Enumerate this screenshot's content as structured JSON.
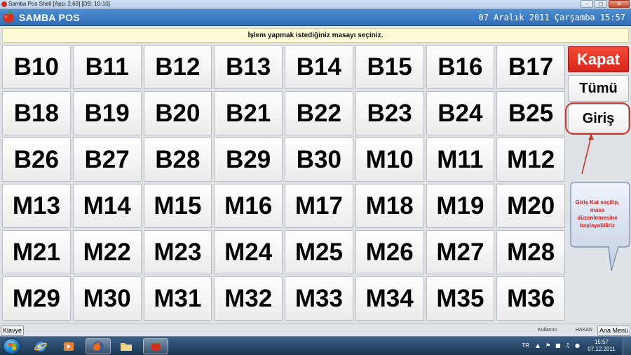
{
  "window": {
    "title": "Samba Pos Shell [App: 2.69] [DB: 10-10]",
    "controls": [
      "minimize-icon",
      "maximize-icon",
      "close-icon"
    ]
  },
  "header": {
    "app_name": "SAMBA POS",
    "datetime": "07 Aralık 2011 Çarşamba 15:57",
    "logo_icon": "apple-icon"
  },
  "instruction": "İşlem yapmak istediğiniz masayı seçiniz.",
  "tables": [
    "B10",
    "B11",
    "B12",
    "B13",
    "B14",
    "B15",
    "B16",
    "B17",
    "B18",
    "B19",
    "B20",
    "B21",
    "B22",
    "B23",
    "B24",
    "B25",
    "B26",
    "B27",
    "B28",
    "B29",
    "B30",
    "M10",
    "M11",
    "M12",
    "M13",
    "M14",
    "M15",
    "M16",
    "M17",
    "M18",
    "M19",
    "M20",
    "M21",
    "M22",
    "M23",
    "M24",
    "M25",
    "M26",
    "M27",
    "M28",
    "M29",
    "M30",
    "M31",
    "M32",
    "M33",
    "M34",
    "M35",
    "M36"
  ],
  "side_panel": {
    "close_label": "Kapat",
    "all_label": "Tümü",
    "login_label": "Giriş",
    "close_color": "#e3321f"
  },
  "callout": {
    "lines": [
      "Giriş Kat seçilip,",
      "masa",
      "düzenlemesine",
      "başlayabiliriz"
    ],
    "color": "#d01d1d"
  },
  "status_bar": {
    "keyboard_label": "Klavye",
    "user_label": "Kullanıcı:",
    "user_name": "HAKAN",
    "main_menu_label": "Ana Menü"
  },
  "taskbar": {
    "items": [
      "windows-start-icon",
      "internet-explorer-icon",
      "media-player-icon",
      "firefox-icon",
      "folder-icon",
      "samba-pos-icon"
    ],
    "language": "TR",
    "time": "15:57",
    "date": "07.12.2011"
  }
}
